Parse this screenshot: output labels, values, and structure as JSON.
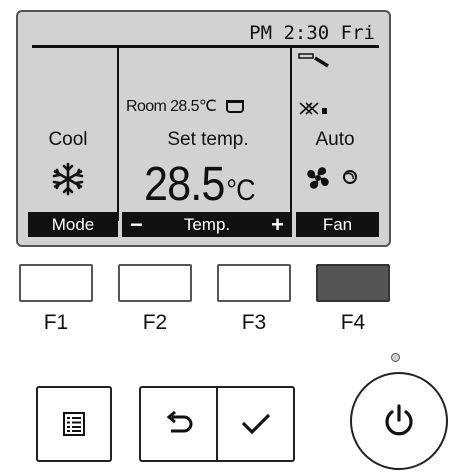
{
  "display": {
    "time": "PM 2:30 Fri",
    "mode_label": "Cool",
    "room_temp_label": "Room 28.5℃",
    "set_temp_label": "Set temp.",
    "set_temp_value": "28.5",
    "set_temp_unit": "°C",
    "fan_speed_label": "Auto",
    "mode_icon": "snowflake-icon",
    "fan_icon": "fan-icon",
    "vane_icon": "vane-icon",
    "louver_icon": "louver-icon"
  },
  "function_bar": {
    "mode": "Mode",
    "temp_minus": "−",
    "temp": "Temp.",
    "temp_plus": "+",
    "fan": "Fan"
  },
  "function_buttons": [
    "F1",
    "F2",
    "F3",
    "F4"
  ],
  "buttons": {
    "menu_icon": "menu-icon",
    "back_icon": "return-icon",
    "confirm_icon": "check-icon",
    "power_icon": "power-icon"
  }
}
